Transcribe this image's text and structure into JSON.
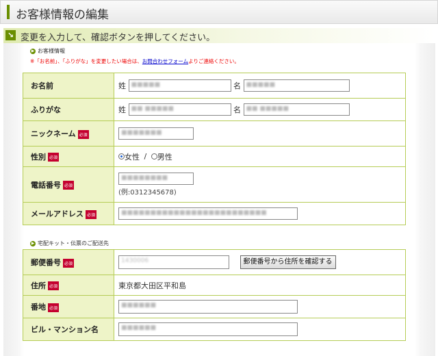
{
  "header": {
    "title": "お客様情報の編集"
  },
  "instruction": {
    "icon": "arrow-down-right-icon",
    "text": "変更を入力して、確認ボタンを押してください。"
  },
  "section_customer": {
    "title": "お客様情報",
    "note_pre": "※「お名前」、「ふりがな」を変更したい場合は、",
    "note_link": "お問合わせフォーム",
    "note_post": "よりご連絡ください。"
  },
  "required_label": "必須",
  "fields": {
    "name": {
      "label": "お名前",
      "last_label": "姓",
      "first_label": "名",
      "last_value": "■■■■■",
      "first_value": "■■■■■"
    },
    "furigana": {
      "label": "ふりがな",
      "last_label": "姓",
      "first_label": "名",
      "last_value": "■■ ■■■■■",
      "first_value": "■■ ■■■■■"
    },
    "nickname": {
      "label": "ニックネーム",
      "value": "■■■■■■■"
    },
    "gender": {
      "label": "性別",
      "option_female": "女性",
      "separator": "/",
      "option_male": "男性",
      "selected": "女性"
    },
    "phone": {
      "label": "電話番号",
      "value": "■■■■■■■■",
      "example": "(例:0312345678)"
    },
    "email": {
      "label": "メールアドレス",
      "value": "■■■■■■■■■■■■■■■■■■■■■■■■■"
    }
  },
  "section_delivery": {
    "title": "宅配キット・伝票のご配送先"
  },
  "delivery_fields": {
    "postal": {
      "label": "郵便番号",
      "value": "1430006",
      "button": "郵便番号から住所を確認する"
    },
    "address": {
      "label": "住所",
      "value": "東京都大田区平和島"
    },
    "street": {
      "label": "番地",
      "value": "■■■■■■"
    },
    "building": {
      "label": "ビル・マンション名",
      "value": "■■■■■■"
    }
  },
  "colors": {
    "accent": "#6a8f00",
    "label_bg": "#eef4c8",
    "border": "#b5cc55",
    "required": "#c4002e",
    "link": "#0000cc"
  }
}
